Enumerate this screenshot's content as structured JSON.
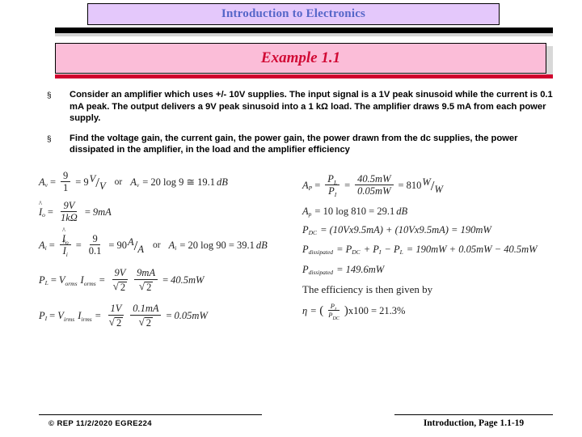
{
  "slide": {
    "title": "Introduction to Electronics",
    "example_heading": "Example 1.1",
    "bullet_marker": "§"
  },
  "bullets": [
    {
      "text": "Consider an amplifier which uses +/- 10V supplies. The input signal is a 1V peak sinusoid while the current is 0.1 mA peak. The output delivers a 9V peak sinusoid into a 1 kΩ load. The amplifier draws 9.5 mA from each power supply."
    },
    {
      "text": "Find the voltage gain, the current gain, the power gain, the power drawn from the dc supplies, the power dissipated in the amplifier, in the load and the amplifier efficiency"
    }
  ],
  "equations": {
    "left": {
      "voltage_gain": {
        "label": "A",
        "label_sub": "v",
        "eq1": "=",
        "num": "9",
        "den": "1",
        "eq2": "=",
        "result": "9",
        "unit_num": "V",
        "unit_den": "V",
        "or": "or",
        "alt_label": "A",
        "alt_label_sub": "v",
        "alt_expr": "= 20 log 9 ≅ 19.1",
        "alt_unit": "dB"
      },
      "output_current": {
        "label": "I",
        "label_sub": "o",
        "eq1": "=",
        "num": "9V",
        "den": "1kΩ",
        "eq2": "=",
        "result": "9mA"
      },
      "current_gain": {
        "label": "A",
        "label_sub": "i",
        "eq1": "=",
        "fnum_label": "I",
        "fnum_sub": "o",
        "fden_label": "I",
        "fden_sub": "i",
        "eq2": "=",
        "num": "9",
        "den": "0.1",
        "eq3": "=",
        "result": "90",
        "unit_num": "A",
        "unit_den": "A",
        "or": "or",
        "alt_label": "A",
        "alt_label_sub": "i",
        "alt_expr": "= 20 log 90 = 39.1",
        "alt_unit": "dB"
      },
      "load_power": {
        "label": "P",
        "label_sub": "L",
        "eq1": "=",
        "v_label": "V",
        "v_sub": "o",
        "v_sub2": "rms",
        "i_label": "I",
        "i_sub": "o",
        "i_sub2": "rms",
        "eq2": "=",
        "f1_num": "9V",
        "f1_den": "2",
        "f2_num": "9mA",
        "f2_den": "2",
        "eq3": "=",
        "result": "40.5mW"
      },
      "input_power": {
        "label": "P",
        "label_sub": "I",
        "eq1": "=",
        "v_label": "V",
        "v_sub": "i",
        "v_sub2": "rms",
        "i_label": "I",
        "i_sub": "i",
        "i_sub2": "rms",
        "eq2": "=",
        "f1_num": "1V",
        "f1_den": "2",
        "f2_num": "0.1mA",
        "f2_den": "2",
        "eq3": "=",
        "result": "0.05mW"
      }
    },
    "right": {
      "power_gain": {
        "label": "A",
        "label_sub": "P",
        "eq1": "=",
        "fnum_label": "P",
        "fnum_sub": "L",
        "fden_label": "P",
        "fden_sub": "I",
        "eq2": "=",
        "num": "40.5mW",
        "den": "0.05mW",
        "eq3": "=",
        "result": "810",
        "unit_num": "W",
        "unit_den": "W"
      },
      "power_gain_db": {
        "label": "A",
        "label_sub": "p",
        "expr": "= 10 log 810 = 29.1",
        "unit": "dB"
      },
      "dc_power": {
        "label": "P",
        "label_sub": "DC",
        "expr": "= (10Vx9.5mA) + (10Vx9.5mA) = 190mW"
      },
      "dissipated_expr": {
        "label": "P",
        "label_sub": "dissipated",
        "expr": "= P",
        "sub1": "DC",
        "expr2": "+ P",
        "sub2": "I",
        "expr3": "− P",
        "sub3": "L",
        "expr4": "= 190mW + 0.05mW − 40.5mW"
      },
      "dissipated_result": {
        "label": "P",
        "label_sub": "dissipated",
        "expr": "= 149.6mW"
      },
      "efficiency_note": "The efficiency is then given by",
      "efficiency": {
        "symbol": "η",
        "eq1": "=",
        "fnum_label": "P",
        "fnum_sub": "L",
        "fden_label": "P",
        "fden_sub": "DC",
        "expr": "x100 = 21.3%"
      }
    }
  },
  "footer": {
    "left": "© REP  11/2/2020  EGRE224",
    "right": "Introduction, Page 1.1-19"
  }
}
